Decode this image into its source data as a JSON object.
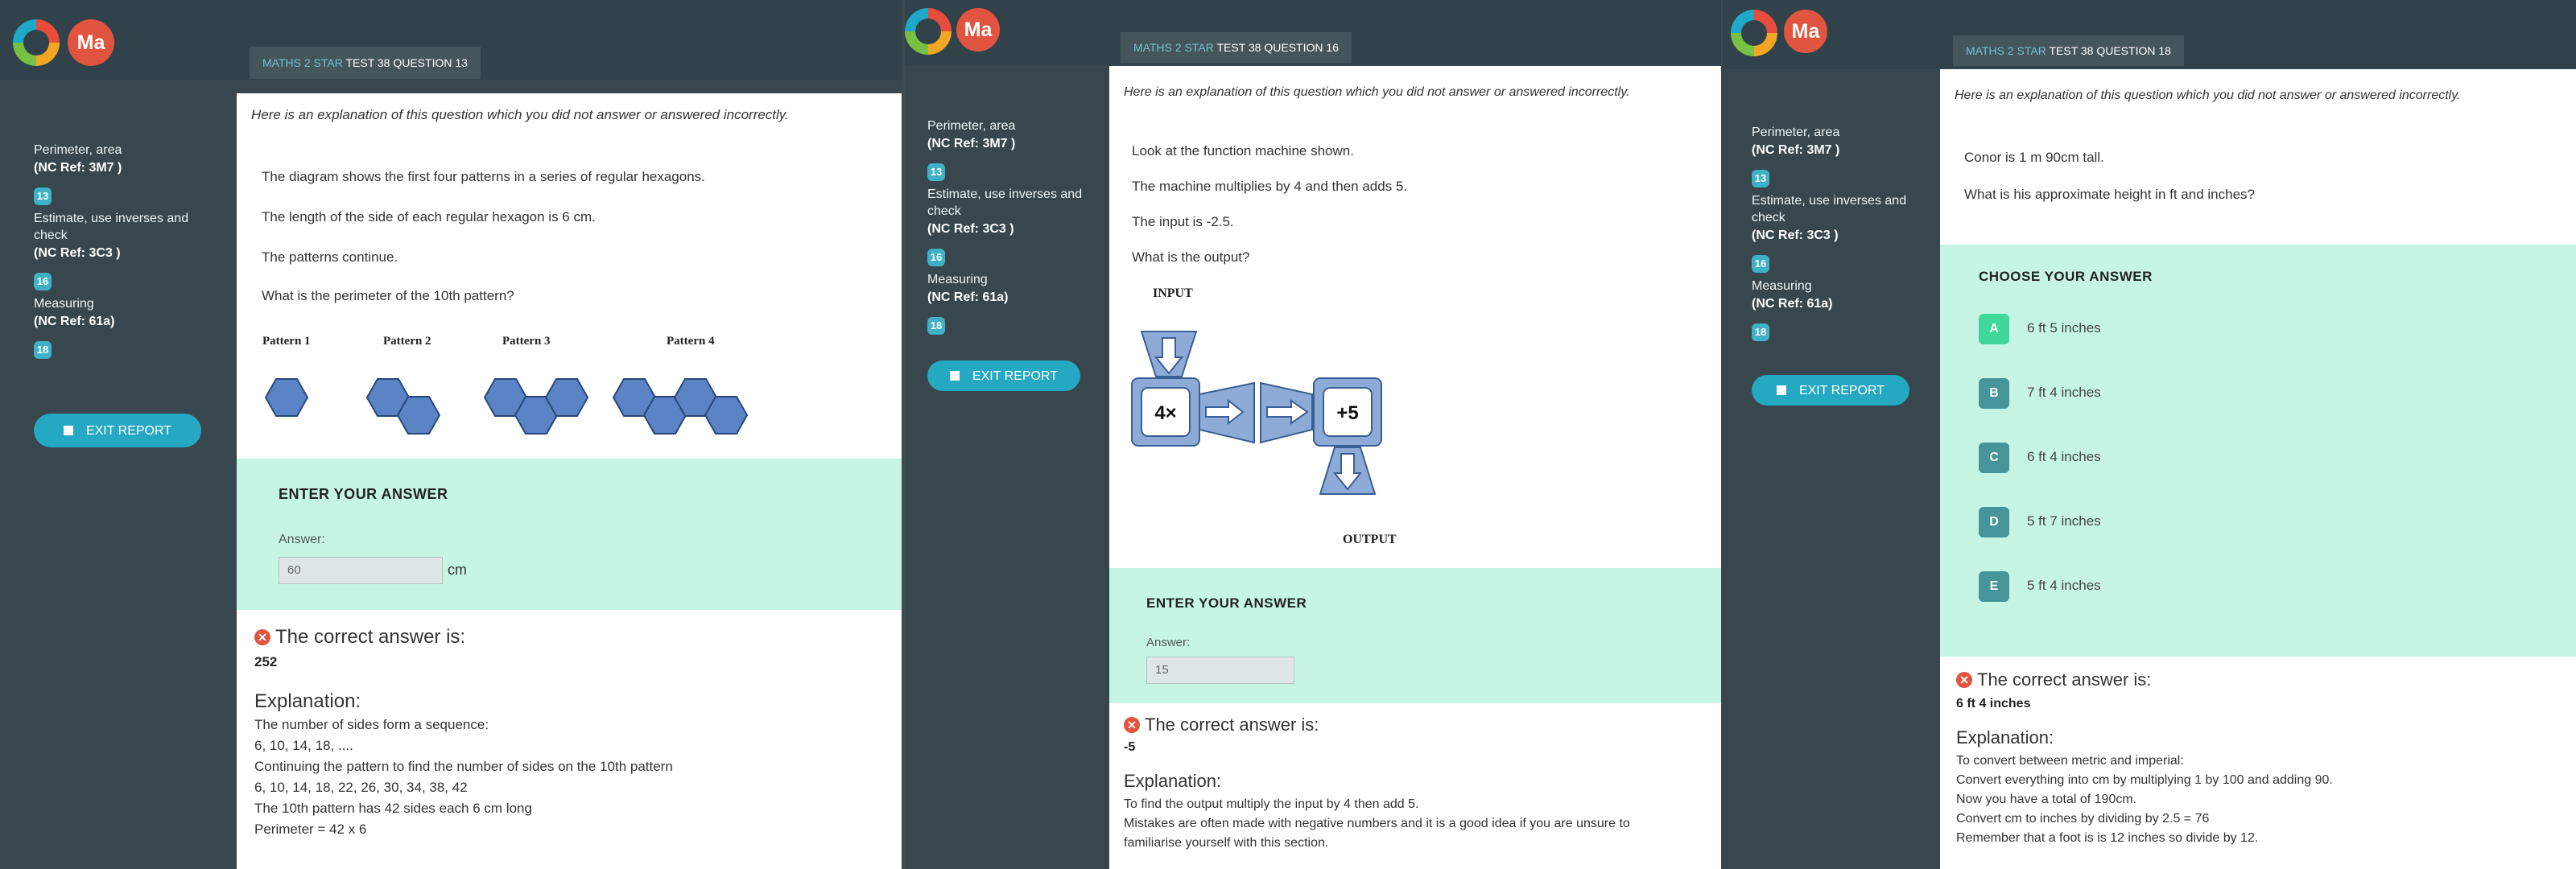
{
  "colors": {
    "accent": "#25a8c2",
    "answer_bg": "#c6f5e4",
    "sidebar_bg": "#37474d",
    "error": "#e05440"
  },
  "user": {
    "initials": "Ma"
  },
  "sidebar": {
    "topics": [
      {
        "label": "Perimeter, area",
        "ref": "(NC Ref: 3M7 )",
        "count": "13"
      },
      {
        "label": "Estimate, use inverses and check",
        "ref": "(NC Ref: 3C3 )",
        "count": "16"
      },
      {
        "label": "Measuring",
        "ref": "(NC Ref: 61a)",
        "count": "18"
      }
    ],
    "exit_label": "EXIT REPORT"
  },
  "intro": "Here is an explanation of this question which you did not answer or answered incorrectly.",
  "enter_answer_title": "ENTER YOUR ANSWER",
  "choose_answer_title": "CHOOSE YOUR ANSWER",
  "answer_label": "Answer:",
  "correct_heading": "The correct answer is:",
  "explanation_heading": "Explanation:",
  "q13": {
    "tab_subject": "MATHS 2 STAR",
    "tab_rest": "TEST 38 QUESTION 13",
    "lines": [
      "The diagram shows the first four patterns in a series of regular hexagons.",
      "The length of the side of each regular hexagon is 6 cm.",
      "The patterns continue.",
      "What is the perimeter of the 10th pattern?"
    ],
    "patterns": [
      "Pattern 1",
      "Pattern 2",
      "Pattern 3",
      "Pattern 4"
    ],
    "answer": "60",
    "unit": "cm",
    "correct": "252",
    "explanation": [
      "The number of sides form a sequence:",
      "6, 10, 14, 18, ....",
      "Continuing the pattern to find the number of sides on the 10th pattern",
      "6, 10, 14, 18, 22, 26, 30, 34, 38, 42",
      "The 10th pattern has 42 sides each 6 cm long",
      "Perimeter = 42 x 6"
    ]
  },
  "q16": {
    "tab_subject": "MATHS 2 STAR",
    "tab_rest": "TEST 38 QUESTION 16",
    "lines": [
      "Look at the function machine shown.",
      "The machine multiplies by 4 and then adds 5.",
      "The input is -2.5.",
      "What is the output?"
    ],
    "input_label": "INPUT",
    "output_label": "OUTPUT",
    "op1": "4×",
    "op2": "+5",
    "answer": "15",
    "correct": "-5",
    "explanation": [
      "To find the output multiply the input by 4 then add 5.",
      "Mistakes are often made with negative numbers and it is a good idea if you are unsure to",
      "familiarise yourself with this section."
    ]
  },
  "q18": {
    "tab_subject": "MATHS 2 STAR",
    "tab_rest": "TEST 38 QUESTION 18",
    "lines": [
      "Conor is 1 m 90cm tall.",
      "What is his approximate height in ft and inches?"
    ],
    "choices": [
      {
        "letter": "A",
        "text": "6 ft 5 inches",
        "color": "#3fd79a"
      },
      {
        "letter": "B",
        "text": "7 ft 4 inches",
        "color": "#45959a"
      },
      {
        "letter": "C",
        "text": "6 ft 4 inches",
        "color": "#45959a"
      },
      {
        "letter": "D",
        "text": "5 ft 7 inches",
        "color": "#45959a"
      },
      {
        "letter": "E",
        "text": "5 ft 4 inches",
        "color": "#45959a"
      }
    ],
    "correct": "6 ft 4 inches",
    "explanation": [
      "To convert between metric and imperial:",
      "Convert everything into cm by multiplying 1 by 100 and adding 90.",
      "Now you have a total of 190cm.",
      "Convert cm to inches by dividing by 2.5 = 76",
      "Remember that a foot is is 12 inches so divide by 12."
    ]
  }
}
